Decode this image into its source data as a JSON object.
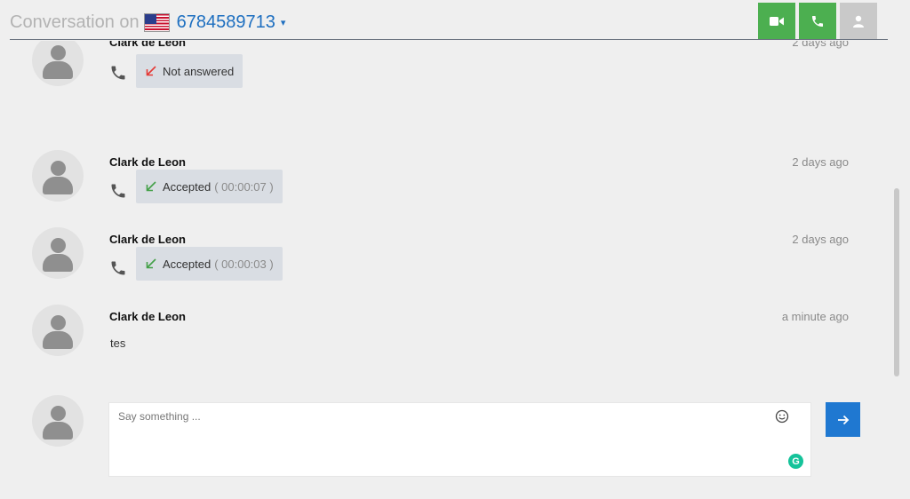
{
  "header": {
    "title_prefix": "Conversation on",
    "flag_icon": "us-flag-icon",
    "phone_number": "6784589713",
    "caret": "▾",
    "buttons": [
      {
        "name": "video-call-button",
        "icon": "video-camera-icon",
        "color": "#4caf50"
      },
      {
        "name": "voice-call-button",
        "icon": "phone-icon",
        "color": "#4caf50"
      },
      {
        "name": "contact-button",
        "icon": "user-icon",
        "color": "#c9c9c9"
      }
    ]
  },
  "messages": [
    {
      "sender": "Clark de Leon",
      "time": "2 days ago",
      "type": "call",
      "status": "Not answered",
      "duration": "",
      "arrow_color": "#e53935"
    },
    {
      "sender": "Clark de Leon",
      "time": "2 days ago",
      "type": "call",
      "status": "Accepted",
      "duration": "( 00:00:07 )",
      "arrow_color": "#43a047"
    },
    {
      "sender": "Clark de Leon",
      "time": "2 days ago",
      "type": "call",
      "status": "Accepted",
      "duration": "( 00:00:03 )",
      "arrow_color": "#43a047"
    },
    {
      "sender": "Clark de Leon",
      "time": "a minute ago",
      "type": "text",
      "text": "tes"
    }
  ],
  "composer": {
    "placeholder": "Say something ...",
    "value": "",
    "emoji_icon": "smiley-icon",
    "grammarly_icon": "grammarly-icon",
    "grammarly_letter": "G",
    "send_icon": "arrow-right-icon",
    "send_color": "#1f78d1"
  }
}
